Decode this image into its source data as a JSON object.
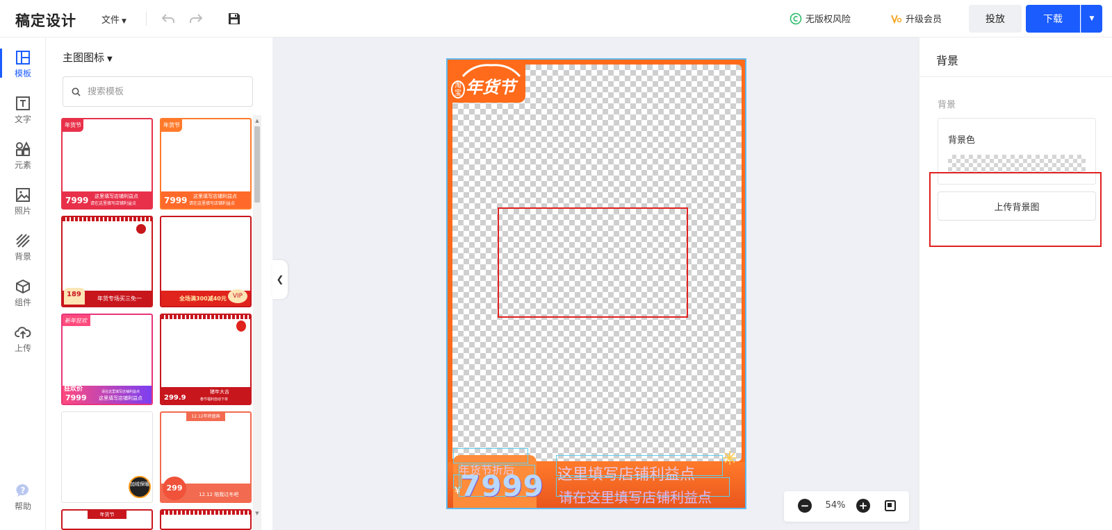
{
  "app": {
    "title": "稿定设计"
  },
  "toolbar": {
    "file_menu": "文件",
    "copyright_label": "无版权风险",
    "vip_label": "升级会员",
    "publish_label": "投放",
    "download_label": "下载"
  },
  "sidebar": {
    "items": [
      {
        "label": "模板",
        "icon": "template-icon"
      },
      {
        "label": "文字",
        "icon": "text-icon"
      },
      {
        "label": "元素",
        "icon": "elements-icon"
      },
      {
        "label": "照片",
        "icon": "photo-icon"
      },
      {
        "label": "背景",
        "icon": "background-icon"
      },
      {
        "label": "组件",
        "icon": "component-icon"
      },
      {
        "label": "上传",
        "icon": "upload-icon"
      }
    ],
    "help_label": "帮助"
  },
  "templates": {
    "category": "主图图标",
    "search_placeholder": "搜索模板",
    "thumbs": [
      {
        "tag": "年货节",
        "price": "7999",
        "line1": "这里填写店铺利益点",
        "line2": "请在这里填写店铺利益点",
        "style": "red"
      },
      {
        "tag": "年货节",
        "price": "7999",
        "line1": "这里填写店铺利益点",
        "line2": "请在这里填写店铺利益点",
        "style": "orange"
      },
      {
        "price": "189",
        "line1": "年货专场买三免一",
        "style": "red-cloud"
      },
      {
        "line1": "全场满300减40元",
        "badge": "VIP",
        "style": "orange-cloud"
      },
      {
        "tag": "新年狂欢",
        "price": "7999",
        "label": "狂欢价",
        "line1": "这里填写店铺利益点",
        "line2": "请在这里填写店铺利益点",
        "style": "pink"
      },
      {
        "price": "299.9",
        "line1": "猪年大吉",
        "line2": "春节福利自动下单",
        "style": "red-lantern"
      },
      {
        "badge": "加绒保暖",
        "style": "white-flame"
      },
      {
        "price": "299",
        "banner": "12.12年终盛典",
        "line1": "12.12 陪我过冬吧",
        "style": "coral"
      },
      {
        "tag": "年货节",
        "style": "red"
      },
      {
        "style": "red"
      }
    ]
  },
  "canvas": {
    "tag_text": "年货节",
    "tag_seal": "淘宝",
    "price_label": "年货节折后",
    "currency": "¥",
    "price": "7999",
    "benefit_main": "这里填写店铺利益点",
    "benefit_sub": "请在这里填写店铺利益点"
  },
  "zoom": {
    "value": "54%"
  },
  "right_panel": {
    "title": "背景",
    "section_label": "背景",
    "color_label": "背景色",
    "upload_label": "上传背景图"
  },
  "colors": {
    "accent": "#1b5cff",
    "brand_orange": "#ff6b1a",
    "highlight_red": "#e02020"
  }
}
